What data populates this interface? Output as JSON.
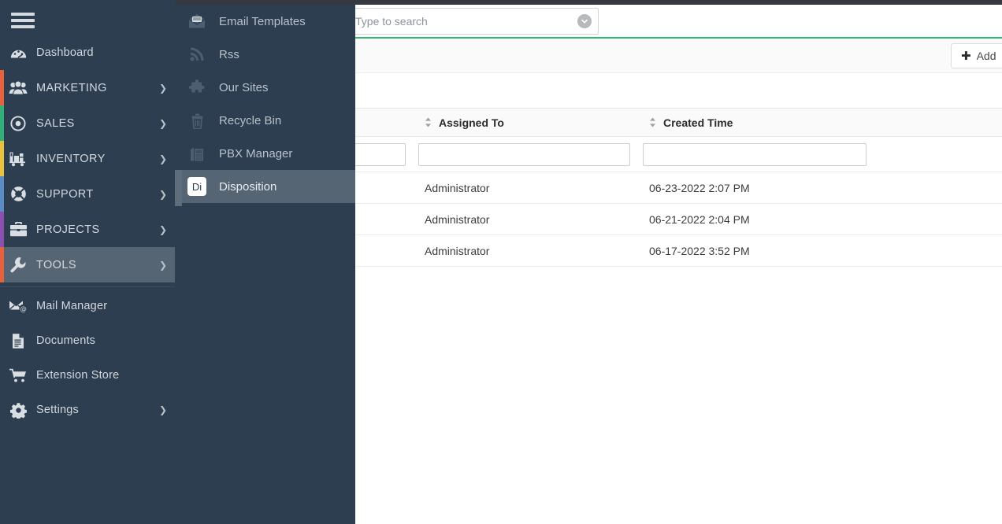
{
  "app": {
    "accent_green": "#31ba6d",
    "sidebar_bg": "#2c3e50",
    "sidebar_active_bg": "#566573"
  },
  "sidebar": {
    "menu_toggle_label": "Toggle menu",
    "primary_items": [
      {
        "label": "Dashboard",
        "icon": "dashboard-icon",
        "accent": "",
        "caret": false,
        "active": false
      },
      {
        "label": "MARKETING",
        "icon": "users-icon",
        "accent": "#e8613c",
        "caret": true,
        "active": false
      },
      {
        "label": "SALES",
        "icon": "target-icon",
        "accent": "#31b179",
        "caret": true,
        "active": false
      },
      {
        "label": "INVENTORY",
        "icon": "inventory-cart-icon",
        "accent": "#e8c23c",
        "caret": true,
        "active": false
      },
      {
        "label": "SUPPORT",
        "icon": "lifebuoy-icon",
        "accent": "#5b8cc4",
        "caret": true,
        "active": false
      },
      {
        "label": "PROJECTS",
        "icon": "briefcase-icon",
        "accent": "#8a4fb0",
        "caret": true,
        "active": false
      },
      {
        "label": "TOOLS",
        "icon": "wrench-icon",
        "accent": "#e8613c",
        "caret": true,
        "active": true
      }
    ],
    "secondary_items": [
      {
        "label": "Mail Manager",
        "icon": "mail-at-icon",
        "caret": false
      },
      {
        "label": "Documents",
        "icon": "document-icon",
        "caret": false
      },
      {
        "label": "Extension Store",
        "icon": "shopping-cart-icon",
        "caret": false
      },
      {
        "label": "Settings",
        "icon": "gear-icon",
        "caret": true
      }
    ]
  },
  "submenu": {
    "items": [
      {
        "label": "Email Templates",
        "icon": "envelope-icon",
        "active": false
      },
      {
        "label": "Rss",
        "icon": "rss-icon",
        "active": false
      },
      {
        "label": "Our Sites",
        "icon": "puzzle-piece-icon",
        "active": false
      },
      {
        "label": "Recycle Bin",
        "icon": "trash-icon",
        "active": false
      },
      {
        "label": "PBX Manager",
        "icon": "phone-system-icon",
        "active": false
      },
      {
        "label": "Disposition",
        "icon": "disposition-badge-icon",
        "badge_text": "Di",
        "active": true
      }
    ]
  },
  "search": {
    "placeholder": "Type to search",
    "value": "",
    "dropdown_icon": "chevron-down-circle-icon"
  },
  "toolbar": {
    "add_label": "Add ",
    "add_icon": "plus-icon"
  },
  "table": {
    "columns": [
      {
        "label": "",
        "sortable": true
      },
      {
        "label": "Assigned To",
        "sortable": true
      },
      {
        "label": "Created Time",
        "sortable": true
      },
      {
        "label": "",
        "sortable": false
      }
    ],
    "filters": [
      "",
      "",
      "",
      ""
    ],
    "rows": [
      {
        "col0": "",
        "assigned_to": "Administrator",
        "created_time": "06-23-2022 2:07 PM",
        "col3": ""
      },
      {
        "col0": "",
        "assigned_to": "Administrator",
        "created_time": "06-21-2022 2:04 PM",
        "col3": ""
      },
      {
        "col0": "",
        "assigned_to": "Administrator",
        "created_time": "06-17-2022 3:52 PM",
        "col3": ""
      }
    ]
  }
}
